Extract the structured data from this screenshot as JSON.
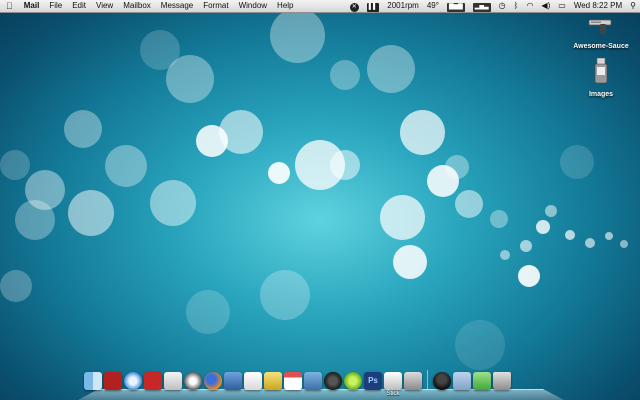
{
  "menubar": {
    "apple": "",
    "app_name": "Mail",
    "menus": [
      "File",
      "Edit",
      "View",
      "Mailbox",
      "Message",
      "Format",
      "Window",
      "Help"
    ],
    "status": {
      "fan_rpm": "2001rpm",
      "temperature": "49°",
      "clock": "Wed 8:22 PM"
    }
  },
  "desktop_icons": [
    {
      "label": "Awesome-Sauce",
      "icon": "gun-icon"
    },
    {
      "label": "Images",
      "icon": "usb-drive-icon"
    }
  ],
  "dock": {
    "label_under_item": "Stick",
    "items": [
      "finder",
      "dictionary",
      "safari",
      "photo-booth",
      "preview",
      "itunes",
      "firefox",
      "automator",
      "textedit",
      "script-editor",
      "ical",
      "iphoto",
      "aperture",
      "green-app",
      "photoshop",
      "stick",
      "app-rect",
      "darth-vader",
      "documents",
      "downloads",
      "trash"
    ]
  },
  "colors": {
    "wallpaper_center": "#5fd2df",
    "wallpaper_edge": "#083d58"
  }
}
